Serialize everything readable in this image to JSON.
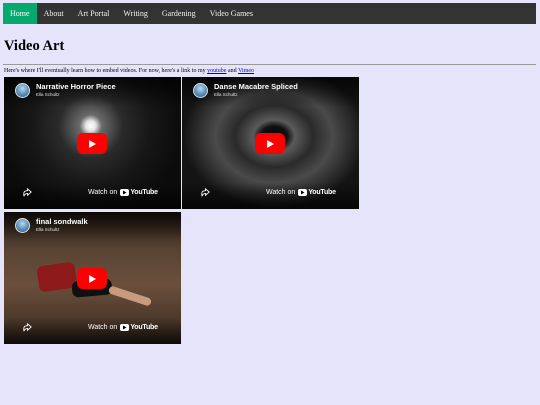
{
  "nav": {
    "items": [
      {
        "label": "Home",
        "active": true
      },
      {
        "label": "About",
        "active": false
      },
      {
        "label": "Art Portal",
        "active": false
      },
      {
        "label": "Writing",
        "active": false
      },
      {
        "label": "Gardening",
        "active": false
      },
      {
        "label": "Video Games",
        "active": false
      }
    ]
  },
  "page": {
    "title": "Video Art",
    "intro_text": "Here's where I'll eventually learn how to embed videos. For now, here's a link to my",
    "link_youtube": "youtube",
    "and_text": "and",
    "link_vimeo": "Vimeo"
  },
  "videos": [
    {
      "title": "Narrative Horror Piece",
      "channel": "Ella Schultz",
      "watch_label": "Watch on",
      "logo_text": "YouTube"
    },
    {
      "title": "Danse Macabre Spliced",
      "channel": "Ella Schultz",
      "watch_label": "Watch on",
      "logo_text": "YouTube"
    },
    {
      "title": "final sondwalk",
      "channel": "Ella Schultz",
      "watch_label": "Watch on",
      "logo_text": "YouTube"
    }
  ],
  "colors": {
    "background": "#e6e4fb",
    "nav_bg": "#333333",
    "nav_active": "#04aa6d",
    "play_button": "#ff0000"
  },
  "icons": [
    "channel-avatar",
    "play-icon",
    "share-icon",
    "youtube-logo-icon"
  ]
}
